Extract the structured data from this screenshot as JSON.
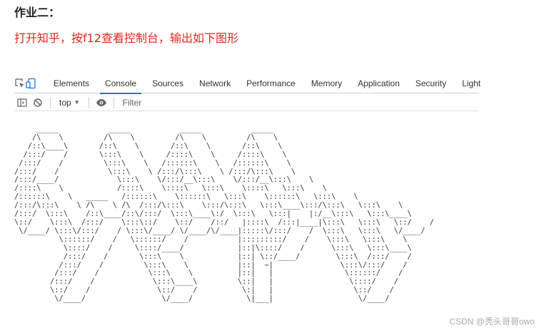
{
  "heading": "作业二：",
  "task": "打开知乎，按f12查看控制台，输出如下图形",
  "devtools": {
    "tabs": [
      "Elements",
      "Console",
      "Sources",
      "Network",
      "Performance",
      "Memory",
      "Application",
      "Security",
      "Light"
    ],
    "active_tab": "Console",
    "context": "top",
    "filter_placeholder": "Filter"
  },
  "console_output": "     _____           _____           _____           _____    \n    /\\    \\         /\\    \\         /\\    \\         /\\    \\   \n   /::\\____\\       /::\\    \\       /::\\    \\       /::\\    \\  \n  /:::/    /       \\:::\\    \\     /::::\\    \\     /::::\\    \\ \n /:::/    /         \\:::\\    \\   /::::::\\    \\   /::::::\\    \\\n/:::/    /           \\:::\\    \\ /:::/\\:::\\    \\ /:::/\\:::\\    \\\n/:::/____/             \\:::\\    \\/:::/__\\:::\\    \\/:::/__\\:::\\    \\\n/::::\\    \\            /::::\\    \\::::\\   \\:::\\    \\::::\\   \\:::\\    \\\n/::::::\\    \\   _____   /::::::\\    \\::::::\\   \\:::\\    \\::::::\\   \\:::\\    \\\n/:::/\\:::\\    \\ /\\    \\ /\\  /:::/\\:::\\    \\:::/\\:::\\   \\:::\\____\\:::/\\:::\\   \\:::\\    \\\n/:::/  \\:::\\    /::\\____/::\\/:::/  \\:::\\____\\:/  \\:::\\   \\:::|    |:/__\\:::\\   \\:::\\____\\\n\\::/    \\:::\\  /:::/    \\:::\\::/    \\::/    /::/   |::::\\  /:::|____|\\:::\\   \\:::\\   \\::/    /\n \\/____/ \\:::\\/:::/    / \\:::\\/____/ \\/____/\\/____|:::::\\/:::/    /  \\:::\\   \\:::\\   \\/____/ \n          \\::::::/    /   \\::::::/    /           |:::::::::/    /    \\:::\\   \\:::\\    \\    \n           \\::::/    /     \\::::/____/            |::|\\::::/    /      \\:::\\   \\:::\\____\\   \n           /:::/    /       \\:::\\    \\            |::| \\::/____/        \\:::\\  /:::/    /   \n          /:::/    /         \\:::\\    \\           |::|  ~|               \\:::\\/:::/    /    \n         /:::/    /           \\:::\\    \\          |::|   |                \\::::::/    /     \n        /:::/    /             \\:::\\____\\         \\::|   |                 \\::::/    /      \n        \\::/    /               \\::/    /          \\:|   |                  \\::/    /       \n         \\/____/                 \\/____/            \\|___|                   \\/____/        ",
  "watermark": "CSDN @秃头哥哥owo"
}
